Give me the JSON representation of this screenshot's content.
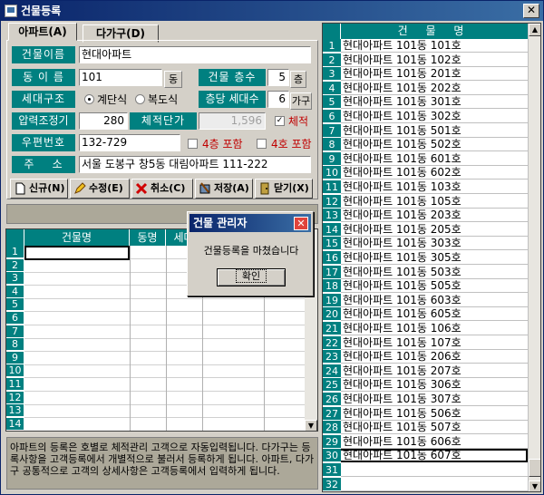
{
  "window": {
    "title": "건물등록",
    "close_glyph": "✕"
  },
  "tabs": [
    "아파트(A)",
    "다가구(D)"
  ],
  "form": {
    "building_name_label": "건물이름",
    "building_name_value": "현대아파트",
    "dong_label": "동 이 름",
    "dong_value": "101",
    "dong_unit": "동",
    "floors_label": "건물 층수",
    "floors_value": "5",
    "floors_unit": "층",
    "household_label": "세대구조",
    "household_option1": "계단식",
    "household_option2": "복도식",
    "per_floor_label": "층당 세대수",
    "per_floor_value": "6",
    "per_floor_unit": "가구",
    "pressure_label": "압력조정기",
    "pressure_value": "280",
    "volume_label": "체적단가",
    "volume_value": "1,596",
    "volume_check_label": "체적",
    "zipcode_label": "우편번호",
    "zipcode_value": "132-729",
    "floor4_label": "4층 포함",
    "room4_label": "4호 포함",
    "address_label": "주    소",
    "address_value": "서울 도봉구 창5동 대림아파트 111-222"
  },
  "buttons": {
    "new": "신규(N)",
    "edit": "수정(E)",
    "cancel": "취소(C)",
    "save": "저장(A)",
    "close": "닫기(X)"
  },
  "left_grid": {
    "headers": [
      "건물명",
      "동명",
      "세대"
    ],
    "rows": [
      "1",
      "2",
      "3",
      "4",
      "5",
      "6",
      "7",
      "8",
      "9",
      "10",
      "11",
      "12",
      "13",
      "14"
    ]
  },
  "notice": "아파트의 등록은 호별로 체적관리 고객으로 자동입력됩니다. 다가구는 등록사항을 고객등록에서 개별적으로 불러서 등록하게 됩니다. 아파트, 다가구 공통적으로 고객의 상세사항은 고객등록에서 입력하게 됩니다.",
  "right_grid": {
    "header": "건 물 명",
    "selected_row": 30,
    "rows": [
      {
        "n": "1",
        "name": "현대아파트 101동 101호"
      },
      {
        "n": "2",
        "name": "현대아파트 101동 102호"
      },
      {
        "n": "3",
        "name": "현대아파트 101동 201호"
      },
      {
        "n": "4",
        "name": "현대아파트 101동 202호"
      },
      {
        "n": "5",
        "name": "현대아파트 101동 301호"
      },
      {
        "n": "6",
        "name": "현대아파트 101동 302호"
      },
      {
        "n": "7",
        "name": "현대아파트 101동 501호"
      },
      {
        "n": "8",
        "name": "현대아파트 101동 502호"
      },
      {
        "n": "9",
        "name": "현대아파트 101동 601호"
      },
      {
        "n": "10",
        "name": "현대아파트 101동 602호"
      },
      {
        "n": "11",
        "name": "현대아파트 101동 103호"
      },
      {
        "n": "12",
        "name": "현대아파트 101동 105호"
      },
      {
        "n": "13",
        "name": "현대아파트 101동 203호"
      },
      {
        "n": "14",
        "name": "현대아파트 101동 205호"
      },
      {
        "n": "15",
        "name": "현대아파트 101동 303호"
      },
      {
        "n": "16",
        "name": "현대아파트 101동 305호"
      },
      {
        "n": "17",
        "name": "현대아파트 101동 503호"
      },
      {
        "n": "18",
        "name": "현대아파트 101동 505호"
      },
      {
        "n": "19",
        "name": "현대아파트 101동 603호"
      },
      {
        "n": "20",
        "name": "현대아파트 101동 605호"
      },
      {
        "n": "21",
        "name": "현대아파트 101동 106호"
      },
      {
        "n": "22",
        "name": "현대아파트 101동 107호"
      },
      {
        "n": "23",
        "name": "현대아파트 101동 206호"
      },
      {
        "n": "24",
        "name": "현대아파트 101동 207호"
      },
      {
        "n": "25",
        "name": "현대아파트 101동 306호"
      },
      {
        "n": "26",
        "name": "현대아파트 101동 307호"
      },
      {
        "n": "27",
        "name": "현대아파트 101동 506호"
      },
      {
        "n": "28",
        "name": "현대아파트 101동 507호"
      },
      {
        "n": "29",
        "name": "현대아파트 101동 606호"
      },
      {
        "n": "30",
        "name": "현대아파트 101동 607호"
      },
      {
        "n": "31",
        "name": ""
      },
      {
        "n": "32",
        "name": ""
      }
    ]
  },
  "dialog": {
    "title": "건물 관리자",
    "message": "건물등록을 마쳤습니다",
    "ok": "확인",
    "close_glyph": "✕"
  }
}
